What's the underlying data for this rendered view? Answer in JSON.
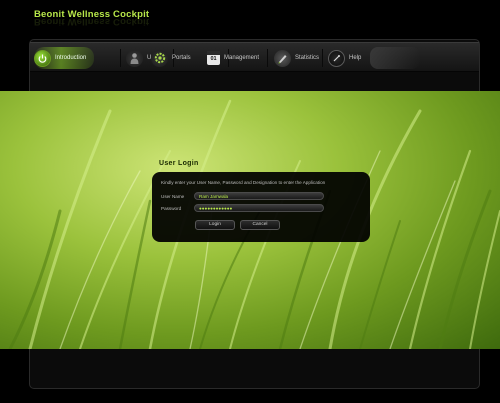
{
  "app": {
    "title": "Beonit Wellness Cockpit"
  },
  "nav": {
    "items": [
      {
        "label": "Introduction",
        "icon": "power-icon",
        "active": true
      },
      {
        "label": "Users",
        "icon": "user-icon",
        "active": false
      },
      {
        "label": "Portals",
        "icon": "gear-icon",
        "active": false
      },
      {
        "label": "Management",
        "icon": "calendar-icon",
        "calendar_day": "01",
        "active": false
      },
      {
        "label": "Statistics",
        "icon": "pen-icon",
        "active": false
      },
      {
        "label": "Help",
        "icon": "help-icon",
        "active": false
      }
    ]
  },
  "login": {
    "title": "User Login",
    "instruction": "Kindly enter your User Name, Password and Designation to enter the Application",
    "username_label": "User Name",
    "username_value": "Ram Jamwala",
    "password_label": "Password",
    "password_value": "●●●●●●●●●●●●",
    "login_label": "Login",
    "cancel_label": "Cancel"
  },
  "colors": {
    "accent": "#b8e84a",
    "background": "#000000",
    "panel": "#0b0b0b",
    "hero_green": "#9bc23c"
  }
}
